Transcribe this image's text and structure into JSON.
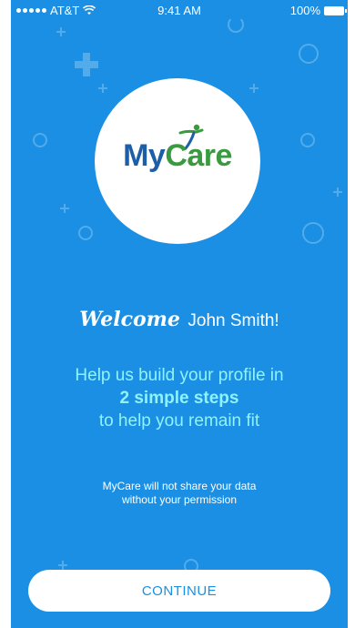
{
  "status_bar": {
    "carrier": "AT&T",
    "time": "9:41 AM",
    "battery": "100%"
  },
  "logo": {
    "my": "My",
    "care": "Care",
    "my_color": "#1c5fa8",
    "care_color": "#3a9a3f"
  },
  "welcome": {
    "greeting": "Welcome",
    "name": "John Smith!"
  },
  "subtitle": {
    "line1": "Help us build your profile in",
    "line2": "2 simple steps",
    "line3": "to help you remain fit"
  },
  "privacy": {
    "line1": "MyCare will not share your data",
    "line2": "without your permission"
  },
  "continue_label": "CONTINUE",
  "colors": {
    "background": "#1a8fe3",
    "subtitle": "#8ff3ff"
  }
}
